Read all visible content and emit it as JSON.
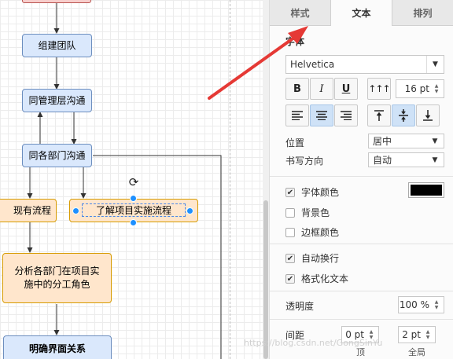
{
  "canvas": {
    "nodes": {
      "build_team": "组建团队",
      "mgmt_comm": "同管理层沟通",
      "dept_comm": "同各部门沟通",
      "existing_process": "现有流程",
      "understand_impl": "了解项目实施流程",
      "analyze_roles": "分析各部门在项目实施中的分工角色",
      "define_ui": "明确界面关系"
    },
    "rotate_icon": "rotate-icon"
  },
  "panel": {
    "tabs": [
      {
        "label": "样式",
        "active": false
      },
      {
        "label": "文本",
        "active": true
      },
      {
        "label": "排列",
        "active": false
      }
    ],
    "font": {
      "section_title": "字体",
      "family": "Helvetica",
      "bold": "B",
      "italic": "I",
      "underline": "U",
      "size": "16 pt"
    },
    "position": {
      "label": "位置",
      "value": "居中"
    },
    "writing_direction": {
      "label": "书写方向",
      "value": "自动"
    },
    "checks": {
      "font_color": {
        "label": "字体颜色",
        "checked": true,
        "color": "#000000"
      },
      "background_color": {
        "label": "背景色",
        "checked": false
      },
      "border_color": {
        "label": "边框颜色",
        "checked": false
      },
      "word_wrap": {
        "label": "自动换行",
        "checked": true
      },
      "formatted_text": {
        "label": "格式化文本",
        "checked": true
      }
    },
    "opacity": {
      "label": "透明度",
      "value": "100 %"
    },
    "spacing": {
      "label": "间距",
      "top": {
        "value": "0 pt",
        "label": "顶"
      },
      "global": {
        "value": "2 pt",
        "label": "全局"
      }
    }
  },
  "watermark": "https://blog.csdn.net/GongSinYu",
  "colors": {
    "accent_red": "#e53935",
    "selection_blue": "#1e90ff",
    "active_button": "#cfe2f7"
  }
}
